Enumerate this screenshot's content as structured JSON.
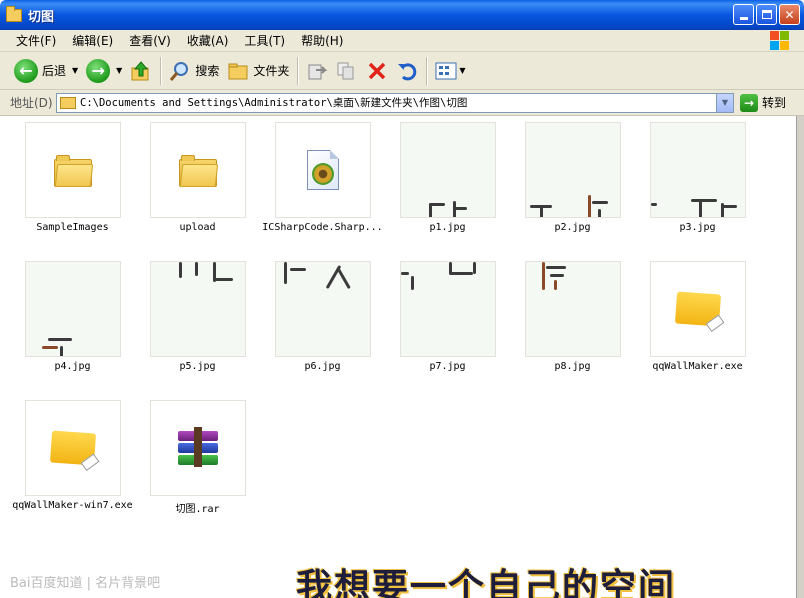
{
  "window": {
    "title": "切图"
  },
  "menu": [
    "文件(F)",
    "编辑(E)",
    "查看(V)",
    "收藏(A)",
    "工具(T)",
    "帮助(H)"
  ],
  "toolbar": {
    "back": "后退",
    "search": "搜索",
    "folders": "文件夹"
  },
  "address": {
    "label": "地址(D)",
    "path": "C:\\Documents and Settings\\Administrator\\桌面\\新建文件夹\\作图\\切图",
    "go": "转到"
  },
  "files": [
    {
      "name": "SampleImages",
      "icon": "folder-icon",
      "selected": true
    },
    {
      "name": "upload",
      "icon": "folder-icon"
    },
    {
      "name": "ICSharpCode.Sharp...",
      "icon": "cs-file-icon"
    },
    {
      "name": "p1.jpg",
      "icon": "image-thumbnail"
    },
    {
      "name": "p2.jpg",
      "icon": "image-thumbnail"
    },
    {
      "name": "p3.jpg",
      "icon": "image-thumbnail"
    },
    {
      "name": "p4.jpg",
      "icon": "image-thumbnail"
    },
    {
      "name": "p5.jpg",
      "icon": "image-thumbnail"
    },
    {
      "name": "p6.jpg",
      "icon": "image-thumbnail"
    },
    {
      "name": "p7.jpg",
      "icon": "image-thumbnail"
    },
    {
      "name": "p8.jpg",
      "icon": "image-thumbnail"
    },
    {
      "name": "qqWallMaker.exe",
      "icon": "app-icon"
    },
    {
      "name": "qqWallMaker-win7.exe",
      "icon": "app-icon"
    },
    {
      "name": "切图.rar",
      "icon": "rar-archive-icon"
    }
  ],
  "overlay": {
    "watermark": "Bai百度知道 | 名片背景吧",
    "caption": "我想要一个自己的空间"
  }
}
